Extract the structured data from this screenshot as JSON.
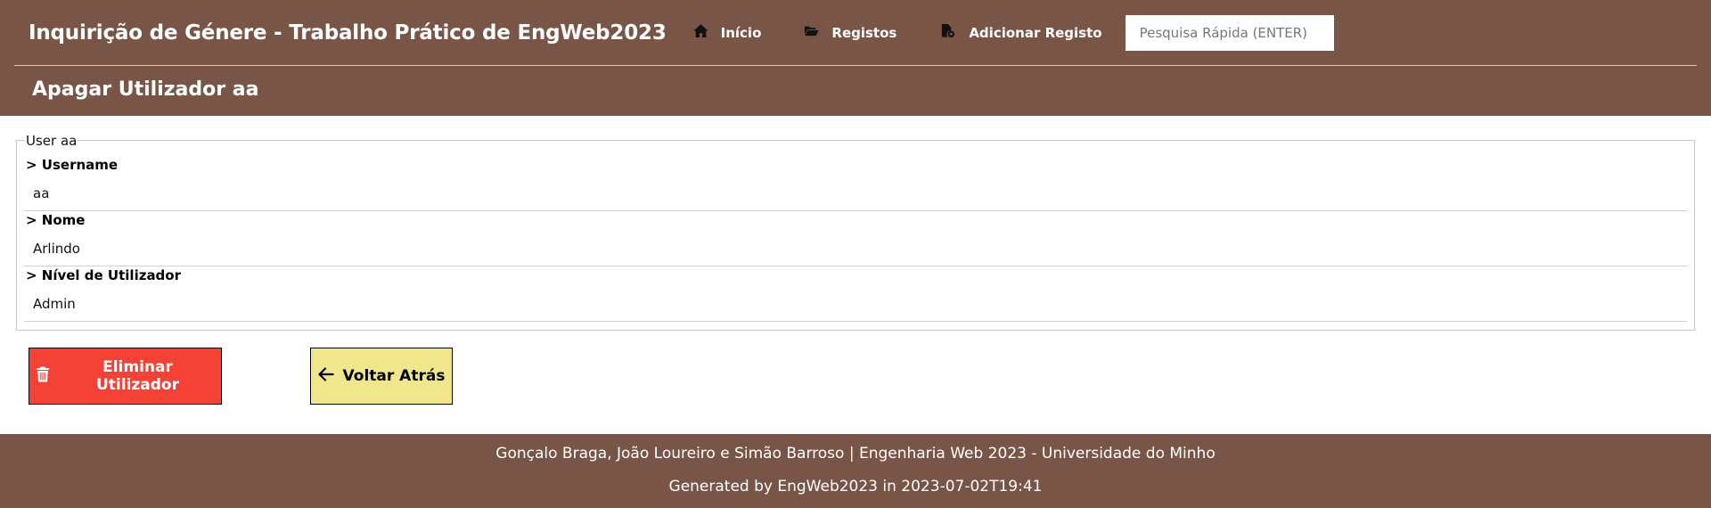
{
  "header": {
    "brand": "Inquirição de Génere - Trabalho Prático de EngWeb2023",
    "nav": [
      {
        "label": "Início",
        "icon": "home-icon"
      },
      {
        "label": "Registos",
        "icon": "folder-open-icon"
      },
      {
        "label": "Adicionar Registo",
        "icon": "file-add-icon"
      }
    ],
    "search_placeholder": "Pesquisa Rápida (ENTER)",
    "page_title": "Apagar Utilizador aa"
  },
  "user_card": {
    "legend": "User aa",
    "fields": [
      {
        "label": "> Username",
        "value": "aa"
      },
      {
        "label": "> Nome",
        "value": "Arlindo"
      },
      {
        "label": "> Nível de Utilizador",
        "value": "Admin"
      }
    ]
  },
  "actions": {
    "delete_label": "Eliminar Utilizador",
    "back_label": "Voltar Atrás",
    "delete_color": "#f44336",
    "back_color": "#f0e68c"
  },
  "footer": {
    "credits": "Gonçalo Braga, João Loureiro e Simão Barroso | Engenharia Web 2023 - Universidade do Minho",
    "generated": "Generated by EngWeb2023 in 2023-07-02T19:41"
  },
  "colors": {
    "header_bg": "#795548"
  }
}
